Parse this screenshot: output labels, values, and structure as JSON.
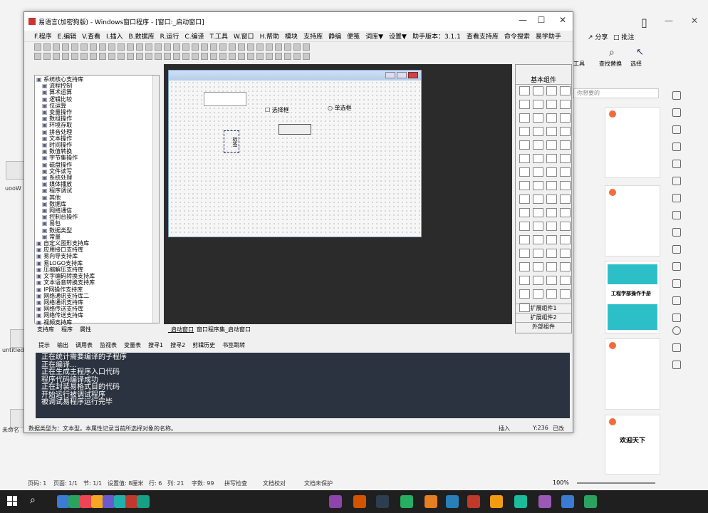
{
  "window": {
    "title": "易语言(加密狗版) - Windows窗口程序 - [窗口:_启动窗口]",
    "min": "—",
    "max": "☐",
    "close": "✕"
  },
  "menu": [
    "F.程序",
    "E.编辑",
    "V.查看",
    "I.插入",
    "B.数据库",
    "R.运行",
    "C.编译",
    "T.工具",
    "W.窗口",
    "H.帮助",
    "模块",
    "支持库",
    "静编",
    "便笺",
    "词库▼",
    "设置▼",
    "助手版本：3.1.1",
    "查看支持库",
    "命令搜索",
    "易学助手"
  ],
  "tree": [
    "系统核心支持库",
    "流程控制",
    "算术运算",
    "逻辑比较",
    "位运算",
    "变量操作",
    "数组操作",
    "环境存取",
    "拼音处理",
    "文本操作",
    "时间操作",
    "数值转换",
    "字节集操作",
    "磁盘操作",
    "文件读写",
    "系统处理",
    "媒体播放",
    "程序调试",
    "其他",
    "数据库",
    "网络通信",
    "控制台操作",
    "易包",
    "数据类型",
    "常量",
    "自定义图形支持库",
    "应用接口支持库",
    "易向导支持库",
    "易LOGO支持库",
    "压缩解压支持库",
    "文字编码转换支持库",
    "文本语音转换支持库",
    "IP网操作支持库",
    "网络通讯支持库二",
    "网络通讯支持库",
    "网络传送支持库",
    "网络传送支持库",
    "视频支持库"
  ],
  "lefttabs": {
    "t1": "支持库",
    "t2": "程序",
    "t3": "属性"
  },
  "form": {
    "checkbox": "选择框",
    "radio": "单选框",
    "label": "标签"
  },
  "tabs": {
    "t1": "_启动窗口",
    "t2": "窗口程序集_启动窗口"
  },
  "components": {
    "title": "基本组件",
    "ext1": "扩展组件1",
    "ext2": "扩展组件2",
    "ext3": "外部组件"
  },
  "outtabs": [
    "提示",
    "输出",
    "调用表",
    "监视表",
    "变量表",
    "搜寻1",
    "搜寻2",
    "剪辑历史",
    "书签跳转"
  ],
  "output": [
    "正在统计需要编译的子程序",
    "正在编译...",
    "正在生成主程序入口代码",
    "程序代码编译成功",
    "正在封装易格式目的代码",
    "开始运行被调试程序",
    "被调试易程序运行完毕"
  ],
  "status": {
    "text": "数据类型为：文本型。本属性记录当前所选择对象的名称。",
    "mode": "插入",
    "pos": "Y:236",
    "state": "已改"
  },
  "bottom": {
    "page": "页码: 1",
    "pages": "页面: 1/1",
    "sec": "节: 1/1",
    "pos": "设置值: 8厘米",
    "row": "行: 6",
    "col": "列: 21",
    "words": "字数: 99",
    "spell": "拼写检查",
    "compare": "文档校对",
    "protect": "文档未保护",
    "zoom": "100%"
  },
  "right": {
    "share": "分享",
    "annot": "批注",
    "find": "查找替换",
    "select": "选择",
    "tools": "工具",
    "search": "你想要的"
  },
  "thumbs": {
    "t3": "工程学部操作手册",
    "t5": "欢迎天下"
  },
  "desktop": {
    "a": "uooW",
    "b": "untitled",
    "c": "未命名"
  }
}
